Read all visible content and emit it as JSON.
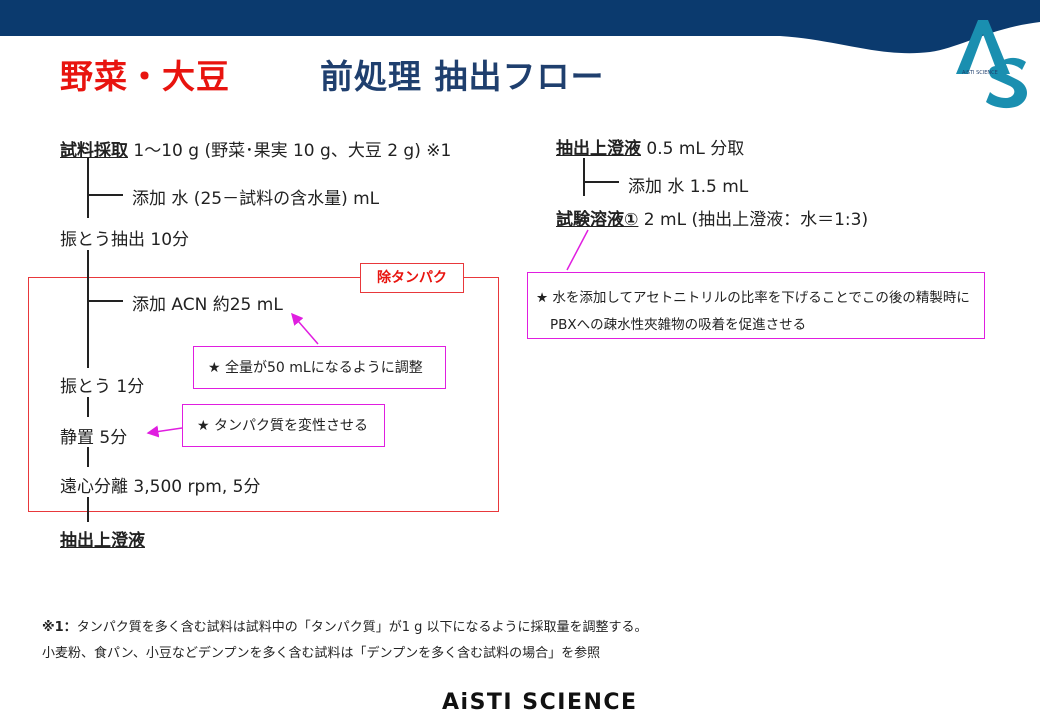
{
  "header": {
    "title_red": "野菜・大豆",
    "title_blue": "前処理 抽出フロー",
    "logo_letters": "AS",
    "logo_small": "AiSTI SCIENCE"
  },
  "flow_left": {
    "step1_label": "試料採取",
    "step1_text": " 1～10 g (野菜･果実 10 g、大豆 2 g) ※1",
    "add_water": "添加 水 (25－試料の含水量) mL",
    "shake_extract": "振とう抽出 10分",
    "add_acn": "添加 ACN 約25 mL",
    "shake1": "振とう 1分",
    "stand": "静置 5分",
    "centrifuge": "遠心分離 3,500 rpm, 5分",
    "supernatant": "抽出上澄液"
  },
  "protein_removal_label": "除タンパク",
  "notes": {
    "adjust_volume": "★ 全量が50 mLになるように調整",
    "denature": "★ タンパク質を変性させる",
    "right_note_line1": "★ 水を添加してアセトニトリルの比率を下げることでこの後の精製時に",
    "right_note_line2": "PBXへの疎水性夾雑物の吸着を促進させる"
  },
  "flow_right": {
    "sup_label": "抽出上澄液",
    "sup_text": " 0.5 mL 分取",
    "add_water": "添加 水 1.5 mL",
    "test_label": "試験溶液①",
    "test_text": " 2 mL (抽出上澄液：水＝1:3)"
  },
  "footnotes": {
    "line1_mark": "※1：",
    "line1": "タンパク質を多く含む試料は試料中の「タンパク質」が1 g 以下になるように採取量を調整する。",
    "line2": "小麦粉、食パン、小豆などデンプンを多く含む試料は「デンプンを多く含む試料の場合」を参照"
  },
  "footer": {
    "brand": "AiSTI SCIENCE"
  },
  "colors": {
    "navy": "#0b3a6e",
    "red": "#e8140f",
    "magenta": "#e01ee0",
    "teal": "#1a8fb0"
  }
}
